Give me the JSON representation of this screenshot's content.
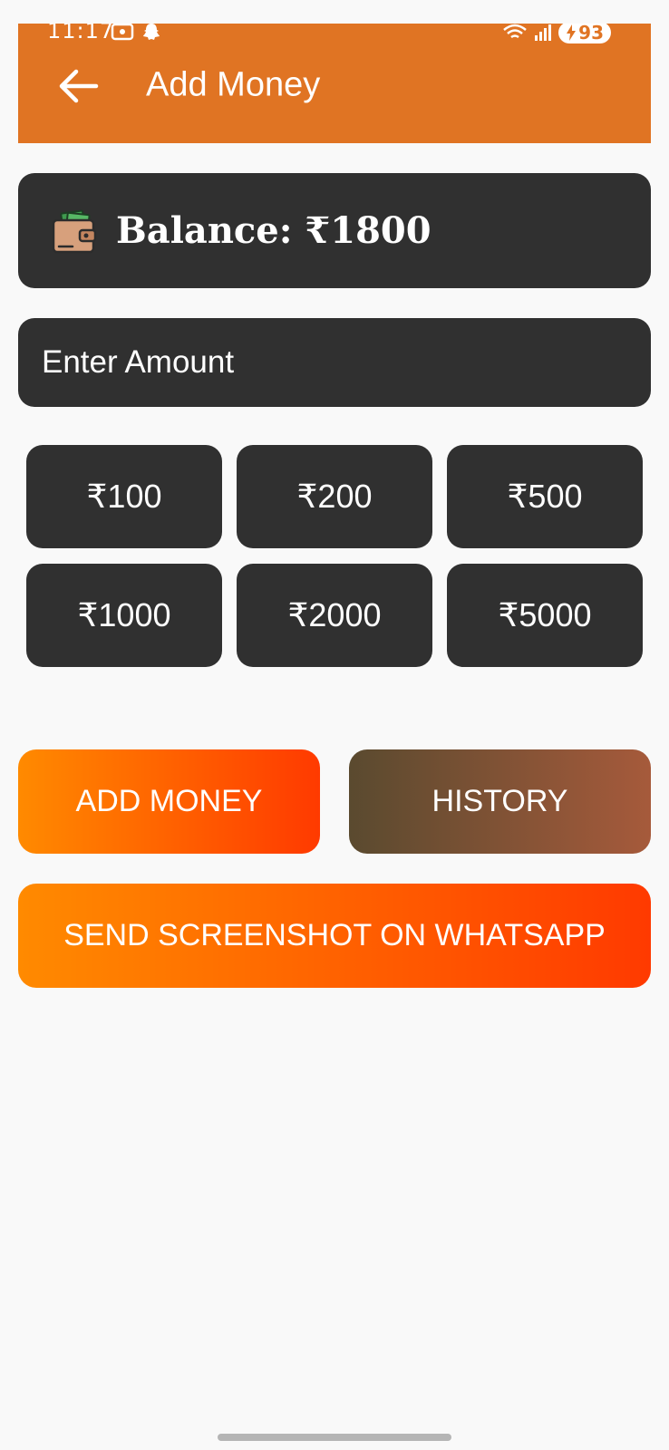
{
  "status_bar": {
    "time": "11:17",
    "battery": "93"
  },
  "app_bar": {
    "title": "Add Money",
    "back_icon": "arrow-left-icon"
  },
  "balance": {
    "icon": "wallet-icon",
    "label": "Balance: ₹1800"
  },
  "amount_input": {
    "placeholder": "Enter Amount",
    "value": ""
  },
  "presets": [
    {
      "label": "₹100"
    },
    {
      "label": "₹200"
    },
    {
      "label": "₹500"
    },
    {
      "label": "₹1000"
    },
    {
      "label": "₹2000"
    },
    {
      "label": "₹5000"
    }
  ],
  "actions": {
    "add_money": "ADD MONEY",
    "history": "HISTORY",
    "whatsapp": "SEND SCREENSHOT ON WHATSAPP"
  },
  "colors": {
    "app_bar": "#e07423",
    "card": "#303030",
    "background": "#f9f9f9",
    "gradient_orange_start": "#ff8a00",
    "gradient_orange_end": "#ff3a00",
    "gradient_brown_start": "#5a4a2f",
    "gradient_brown_end": "#a65a3b"
  }
}
